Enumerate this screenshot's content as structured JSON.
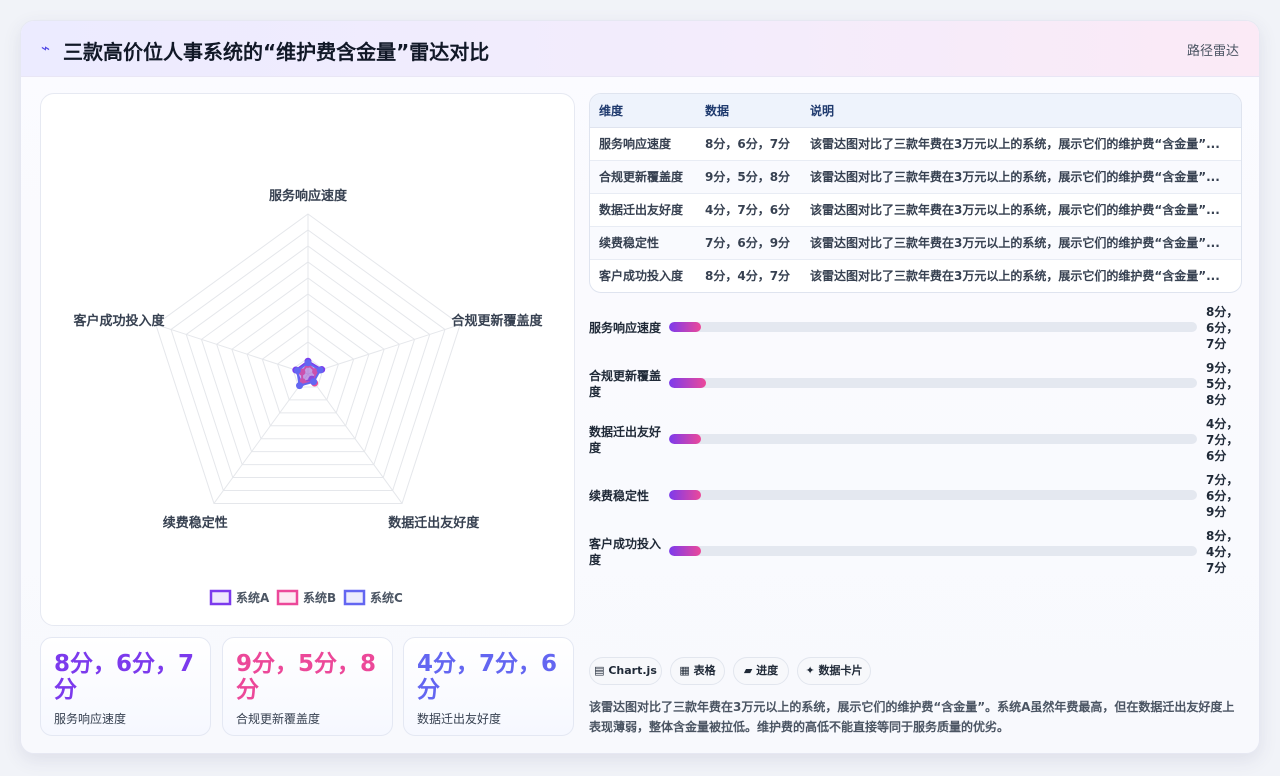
{
  "header": {
    "logo_icon": "wave-icon",
    "title": "三款高价位人事系统的“维护费含金量”雷达对比",
    "tag": "路径雷达"
  },
  "chart_data": {
    "type": "radar",
    "axes": [
      "服务响应速度",
      "合规更新覆盖度",
      "数据迁出友好度",
      "续费稳定性",
      "客户成功投入度"
    ],
    "rmax": 100,
    "rings": 10,
    "series": [
      {
        "name": "系统A",
        "values": [
          8,
          9,
          4,
          7,
          8
        ],
        "color": "#7c3aed"
      },
      {
        "name": "系统B",
        "values": [
          6,
          5,
          7,
          6,
          4
        ],
        "color": "#ec4899"
      },
      {
        "name": "系统C",
        "values": [
          7,
          8,
          6,
          9,
          7
        ],
        "color": "#6366f1"
      }
    ]
  },
  "stats": [
    {
      "value": "8分，6分，7分",
      "label": "服务响应速度",
      "color": "#7c3aed"
    },
    {
      "value": "9分，5分，8分",
      "label": "合规更新覆盖度",
      "color": "#ec4899"
    },
    {
      "value": "4分，7分，6分",
      "label": "数据迁出友好度",
      "color": "#6366f1"
    }
  ],
  "table": {
    "headers": [
      "维度",
      "数据",
      "说明"
    ],
    "rows": [
      [
        "服务响应速度",
        "8分，6分，7分",
        "该雷达图对比了三款年费在3万元以上的系统，展示它们的维护费“含金量”..."
      ],
      [
        "合规更新覆盖度",
        "9分，5分，8分",
        "该雷达图对比了三款年费在3万元以上的系统，展示它们的维护费“含金量”..."
      ],
      [
        "数据迁出友好度",
        "4分，7分，6分",
        "该雷达图对比了三款年费在3万元以上的系统，展示它们的维护费“含金量”..."
      ],
      [
        "续费稳定性",
        "7分，6分，9分",
        "该雷达图对比了三款年费在3万元以上的系统，展示它们的维护费“含金量”..."
      ],
      [
        "客户成功投入度",
        "8分，4分，7分",
        "该雷达图对比了三款年费在3万元以上的系统，展示它们的维护费“含金量”..."
      ]
    ]
  },
  "bars": [
    {
      "label": "服务响应速度",
      "value": "8分，6分，7分",
      "fill_percent": 6
    },
    {
      "label": "合规更新覆盖度",
      "value": "9分，5分，8分",
      "fill_percent": 7
    },
    {
      "label": "数据迁出友好度",
      "value": "4分，7分，6分",
      "fill_percent": 6
    },
    {
      "label": "续费稳定性",
      "value": "7分，6分，9分",
      "fill_percent": 6
    },
    {
      "label": "客户成功投入度",
      "value": "8分，4分，7分",
      "fill_percent": 6
    }
  ],
  "chips": [
    {
      "icon": "chart-icon",
      "label": "Chart.js"
    },
    {
      "icon": "table-icon",
      "label": "表格"
    },
    {
      "icon": "progress-icon",
      "label": "进度"
    },
    {
      "icon": "card-icon",
      "label": "数据卡片"
    }
  ],
  "description": "该雷达图对比了三款年费在3万元以上的系统，展示它们的维护费“含金量”。系统A虽然年费最高，但在数据迁出友好度上表现薄弱，整体含金量被拉低。维护费的高低不能直接等同于服务质量的优劣。"
}
